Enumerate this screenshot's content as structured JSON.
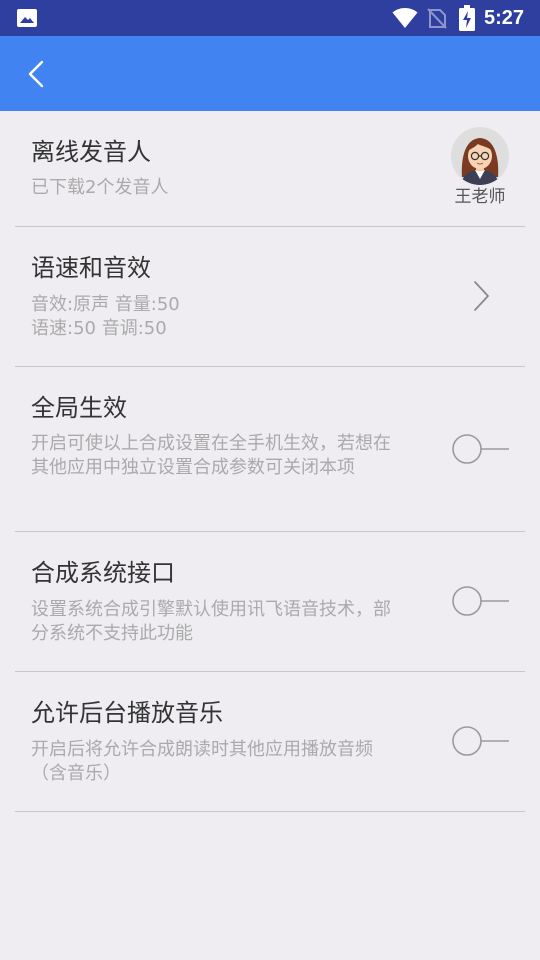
{
  "status_bar": {
    "time": "5:27",
    "icons": [
      "image-icon",
      "wifi-icon",
      "no-sim-icon",
      "battery-charging-icon"
    ]
  },
  "app_bar": {
    "back_icon": "chevron-left-icon"
  },
  "settings": {
    "offline_speaker": {
      "title": "离线发音人",
      "subtitle": "已下载2个发音人",
      "speaker_name": "王老师",
      "avatar_icon": "teacher-avatar"
    },
    "speed_effects": {
      "title": "语速和音效",
      "line1": "音效:原声 音量:50",
      "line2": "语速:50 音调:50",
      "arrow_icon": "chevron-right-icon"
    },
    "global_effect": {
      "title": "全局生效",
      "description": "开启可使以上合成设置在全手机生效，若想在其他应用中独立设置合成参数可关闭本项",
      "enabled": false
    },
    "system_interface": {
      "title": "合成系统接口",
      "description": "设置系统合成引擎默认使用讯飞语音技术，部分系统不支持此功能",
      "enabled": false
    },
    "background_music": {
      "title": "允许后台播放音乐",
      "description": "开启后将允许合成朗读时其他应用播放音频（含音乐）",
      "enabled": false
    }
  },
  "colors": {
    "status_bar": "#2f3f9f",
    "app_bar": "#4183f0",
    "background": "#efedf2",
    "divider": "#c8c7cc",
    "title_text": "#333333",
    "subtitle_text": "#aaaaaa"
  }
}
